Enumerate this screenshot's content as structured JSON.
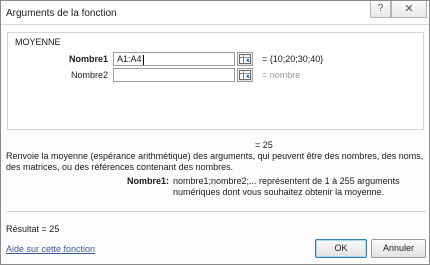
{
  "window": {
    "title": "Arguments de la fonction",
    "help_glyph": "?",
    "close_glyph": "✕"
  },
  "function": {
    "name": "MOYENNE",
    "args": [
      {
        "label": "Nombre1",
        "value": "A1:A4",
        "evaluated": "= {10;20;30;40}"
      },
      {
        "label": "Nombre2",
        "value": "",
        "evaluated": "= nombre"
      }
    ],
    "result_preview": "= 25",
    "description": "Renvoie la moyenne (espérance arithmétique) des arguments, qui peuvent être des nombres, des noms, des matrices, ou des références contenant des nombres.",
    "arg_help_label": "Nombre1:",
    "arg_help_text": "nombre1;nombre2;... représentent de 1 à 255 arguments numériques dont vous souhaitez obtenir la moyenne."
  },
  "footer": {
    "result": "Résultat =  25",
    "help_link": "Aide sur cette fonction",
    "ok_label": "OK",
    "cancel_label": "Annuler"
  },
  "icons": {
    "collapse": "range-select-icon",
    "help": "question-mark-icon",
    "close": "close-icon"
  }
}
